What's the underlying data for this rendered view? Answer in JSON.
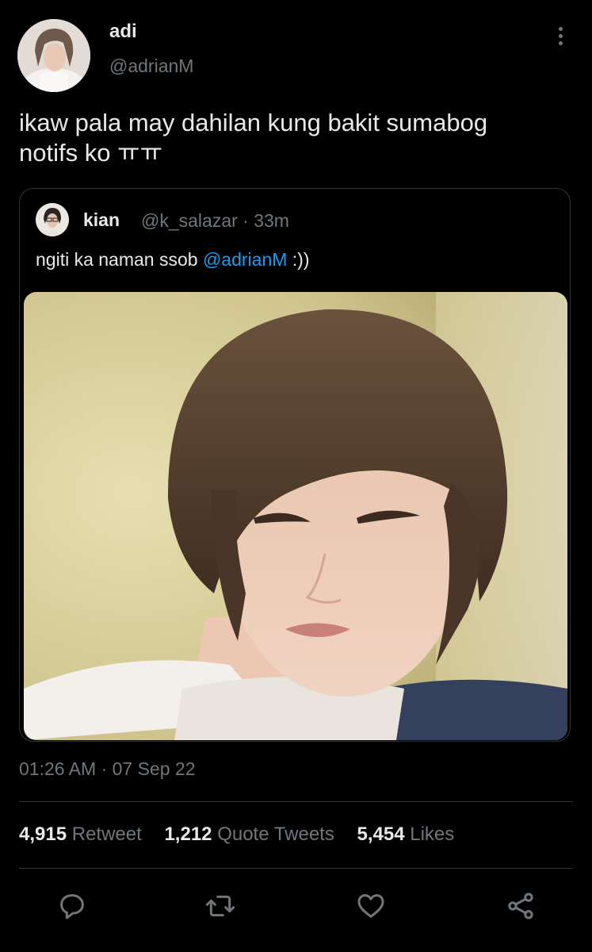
{
  "tweet": {
    "display_name": "adi",
    "handle": "@adrianM",
    "text_line1": "ikaw pala may dahilan kung bakit sumabog",
    "text_line2": "notifs ko ㅠㅠ",
    "timestamp": "01:26 AM · 07 Sep 22"
  },
  "quoted": {
    "display_name": "kian",
    "meta": "@k_salazar · 33m",
    "text_prefix": "ngiti ka naman ssob ",
    "mention": "@adrianM",
    "text_suffix": " :))"
  },
  "stats": {
    "retweets_count": "4,915",
    "retweets_label": "Retweet",
    "quotes_count": "1,212",
    "quotes_label": "Quote Tweets",
    "likes_count": "5,454",
    "likes_label": "Likes"
  },
  "actions": {
    "icons": [
      "reply-icon",
      "retweet-icon",
      "like-icon",
      "share-icon"
    ]
  },
  "colors": {
    "background": "#000000",
    "text": "#e7e9ea",
    "secondary": "#71767b",
    "accent": "#1d9bf0",
    "border": "#2f3336"
  }
}
